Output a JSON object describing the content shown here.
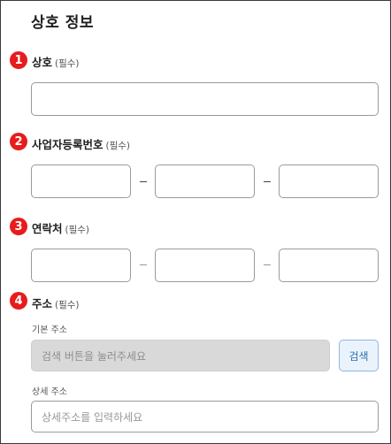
{
  "section_title": "상호 정보",
  "fields": {
    "company_name": {
      "number": "1",
      "label": "상호",
      "required": "(필수)"
    },
    "business_reg": {
      "number": "2",
      "label": "사업자등록번호",
      "required": "(필수)",
      "separator": "–"
    },
    "contact": {
      "number": "3",
      "label": "연락처",
      "required": "(필수)",
      "separator": "–"
    },
    "address": {
      "number": "4",
      "label": "주소",
      "required": "(필수)",
      "basic_label": "기본 주소",
      "basic_placeholder": "검색 버튼을 눌러주세요",
      "search_button": "검색",
      "detail_label": "상세 주소",
      "detail_placeholder": "상세주소를 입력하세요"
    }
  },
  "colors": {
    "badge": "#e81c1c",
    "button_text": "#2f6fb0",
    "button_bg": "#eaf3fc",
    "disabled_bg": "#d9d9d9"
  }
}
